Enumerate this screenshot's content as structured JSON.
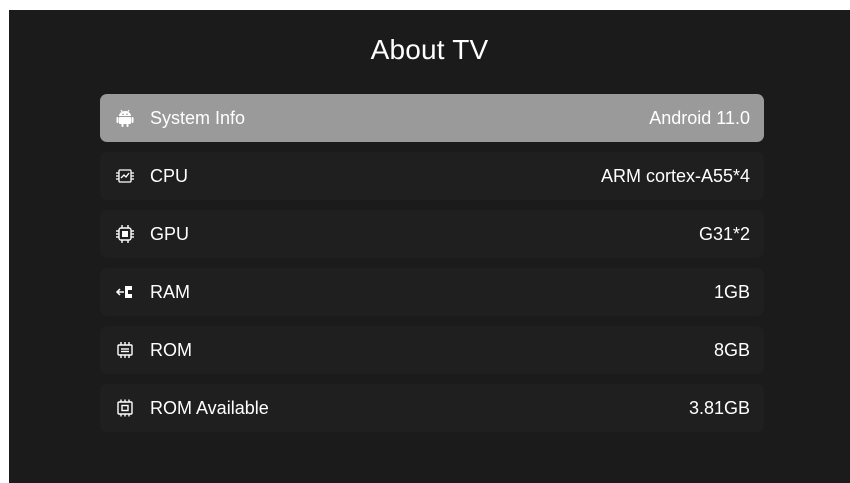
{
  "header": {
    "title": "About TV"
  },
  "items": [
    {
      "label": "System Info",
      "value": "Android 11.0",
      "icon": "android-icon",
      "selected": true
    },
    {
      "label": "CPU",
      "value": "ARM cortex-A55*4",
      "icon": "cpu-icon",
      "selected": false
    },
    {
      "label": "GPU",
      "value": "G31*2",
      "icon": "gpu-chip-icon",
      "selected": false
    },
    {
      "label": "RAM",
      "value": "1GB",
      "icon": "ram-icon",
      "selected": false
    },
    {
      "label": "ROM",
      "value": "8GB",
      "icon": "rom-icon",
      "selected": false
    },
    {
      "label": "ROM Available",
      "value": "3.81GB",
      "icon": "rom-available-icon",
      "selected": false
    }
  ],
  "colors": {
    "background": "#1b1b1b",
    "row": "#1f1f1f",
    "selected_row": "#9a9a9a",
    "text": "#ffffff"
  }
}
